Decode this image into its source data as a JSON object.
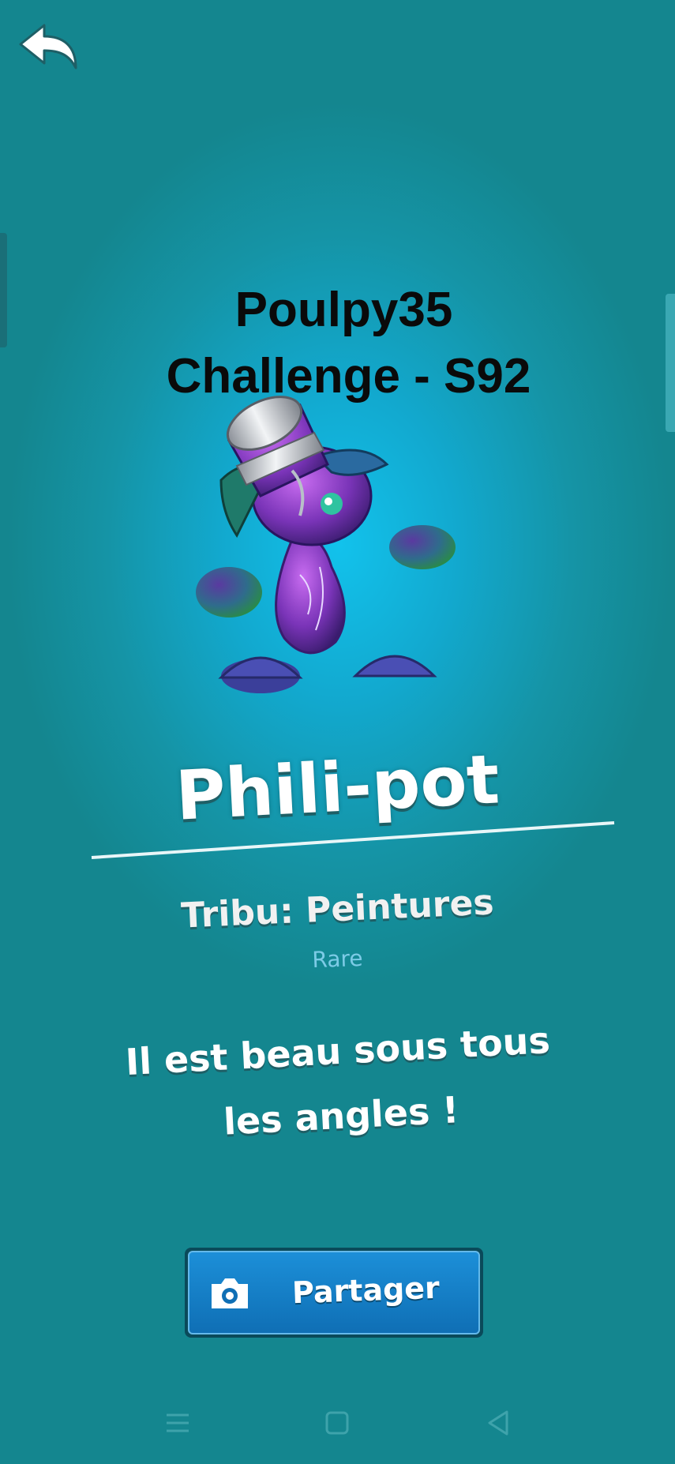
{
  "header": {
    "title_line1": "Poulpy35",
    "title_line2": "Challenge - S92"
  },
  "card": {
    "name": "Phili-pot",
    "tribe": "Tribu: Peintures",
    "rarity": "Rare",
    "description": "Il est beau sous tous les angles !"
  },
  "actions": {
    "share_label": "Partager"
  },
  "icons": {
    "back": "back-arrow-icon",
    "share": "camera-icon",
    "nav_menu": "menu-icon",
    "nav_home": "home-square-icon",
    "nav_back": "back-triangle-icon"
  },
  "colors": {
    "background": "#14868f",
    "glow": "#12c2ec",
    "button": "#1c8fd8",
    "rarity": "#7ccbe6"
  }
}
